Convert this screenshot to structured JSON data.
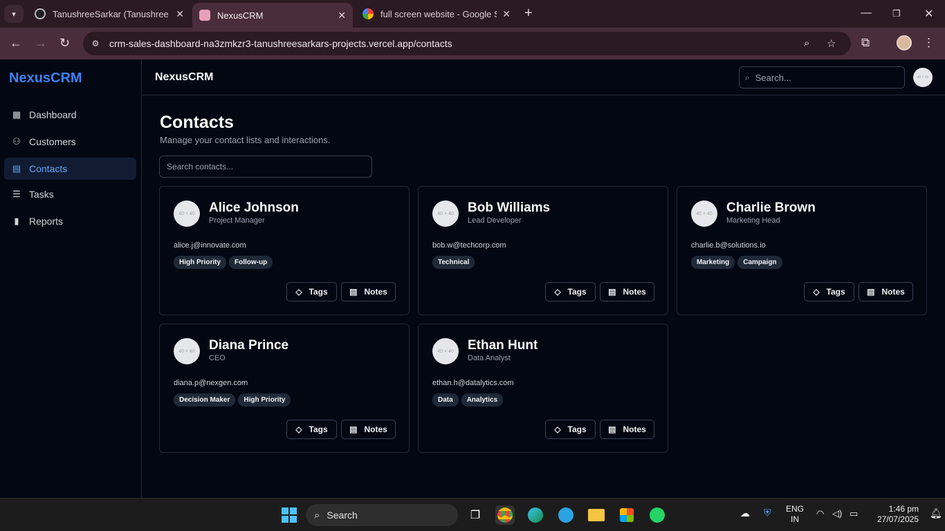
{
  "browser": {
    "tabs": [
      {
        "title": "TanushreeSarkar (Tanushree Sarkar)",
        "active": false
      },
      {
        "title": "NexusCRM",
        "active": true
      },
      {
        "title": "full screen website - Google Search",
        "active": false
      }
    ],
    "url": "crm-sales-dashboard-na3zmkzr3-tanushreesarkars-projects.vercel.app/contacts"
  },
  "sidebar": {
    "brand": "NexusCRM",
    "items": [
      {
        "label": "Dashboard",
        "icon": "dashboard-icon"
      },
      {
        "label": "Customers",
        "icon": "users-icon"
      },
      {
        "label": "Contacts",
        "icon": "contacts-book-icon",
        "active": true
      },
      {
        "label": "Tasks",
        "icon": "tasks-list-icon"
      },
      {
        "label": "Reports",
        "icon": "bar-chart-icon"
      }
    ]
  },
  "header": {
    "title": "NexusCRM",
    "search_placeholder": "Search...",
    "avatar_text": "40 × 40"
  },
  "page": {
    "title": "Contacts",
    "subtitle": "Manage your contact lists and interactions.",
    "search_placeholder": "Search contacts..."
  },
  "contacts": [
    {
      "name": "Alice Johnson",
      "role": "Project Manager",
      "email": "alice.j@innovate.com",
      "tags": [
        "High Priority",
        "Follow-up"
      ],
      "avatar_text": "40 × 40"
    },
    {
      "name": "Bob Williams",
      "role": "Lead Developer",
      "email": "bob.w@techcorp.com",
      "tags": [
        "Technical"
      ],
      "avatar_text": "40 × 40"
    },
    {
      "name": "Charlie Brown",
      "role": "Marketing Head",
      "email": "charlie.b@solutions.io",
      "tags": [
        "Marketing",
        "Campaign"
      ],
      "avatar_text": "40 × 40"
    },
    {
      "name": "Diana Prince",
      "role": "CEO",
      "email": "diana.p@nexgen.com",
      "tags": [
        "Decision Maker",
        "High Priority"
      ],
      "avatar_text": "40 × 40"
    },
    {
      "name": "Ethan Hunt",
      "role": "Data Analyst",
      "email": "ethan.h@datalytics.com",
      "tags": [
        "Data",
        "Analytics"
      ],
      "avatar_text": "40 × 40"
    }
  ],
  "card_buttons": {
    "tags": "Tags",
    "notes": "Notes"
  },
  "taskbar": {
    "search_label": "Search",
    "lang": "ENG",
    "region": "IN",
    "time": "1:46 pm",
    "date": "27/07/2025"
  },
  "colors": {
    "accent": "#3b82f6",
    "background": "#030712",
    "border": "#1f2937"
  }
}
